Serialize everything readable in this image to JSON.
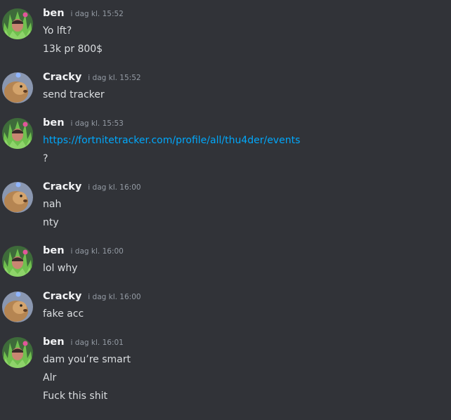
{
  "colors": {
    "background": "#313338",
    "username": "#f2f3f5",
    "timestamp": "#949ba4",
    "message_text": "#dbdee1",
    "link": "#00a8fc"
  },
  "messages": [
    {
      "user": "ben",
      "avatar": "ben-avatar",
      "time": "i dag kl. 15:52",
      "lines": [
        {
          "text": "Yo lft?"
        },
        {
          "text": "13k pr 800$"
        }
      ]
    },
    {
      "user": "Cracky",
      "avatar": "cracky-avatar",
      "time": "i dag kl. 15:52",
      "lines": [
        {
          "text": "send tracker"
        }
      ]
    },
    {
      "user": "ben",
      "avatar": "ben-avatar",
      "time": "i dag kl. 15:53",
      "lines": [
        {
          "text": "https://fortnitetracker.com/profile/all/thu4der/events",
          "is_link": true
        },
        {
          "text": "?"
        }
      ]
    },
    {
      "user": "Cracky",
      "avatar": "cracky-avatar",
      "time": "i dag kl. 16:00",
      "lines": [
        {
          "text": "nah"
        },
        {
          "text": "nty"
        }
      ]
    },
    {
      "user": "ben",
      "avatar": "ben-avatar",
      "time": "i dag kl. 16:00",
      "lines": [
        {
          "text": "lol why"
        }
      ]
    },
    {
      "user": "Cracky",
      "avatar": "cracky-avatar",
      "time": "i dag kl. 16:00",
      "lines": [
        {
          "text": "fake acc"
        }
      ]
    },
    {
      "user": "ben",
      "avatar": "ben-avatar",
      "time": "i dag kl. 16:01",
      "lines": [
        {
          "text": "dam you’re smart"
        },
        {
          "text": "Alr"
        },
        {
          "text": "Fuck this shit"
        }
      ]
    }
  ]
}
